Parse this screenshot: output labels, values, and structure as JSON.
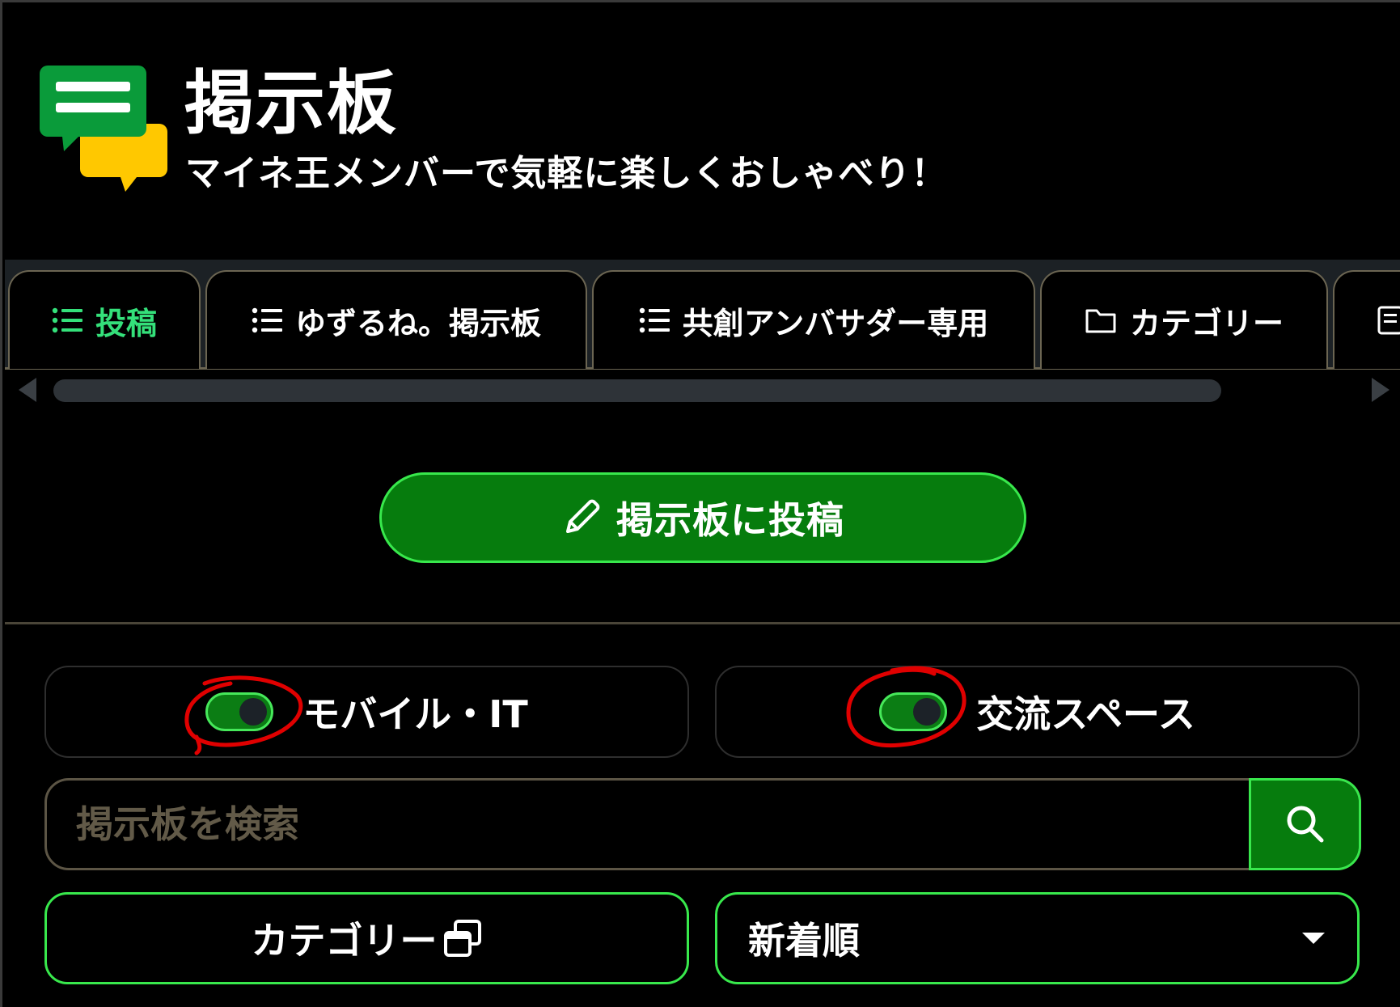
{
  "header": {
    "title": "掲示板",
    "subtitle": "マイネ王メンバーで気軽に楽しくおしゃべり！",
    "logo_icon": "chat-bubbles-icon"
  },
  "tabs": [
    {
      "label": "投稿",
      "icon": "list-icon",
      "active": true
    },
    {
      "label": "ゆずるね。掲示板",
      "icon": "list-icon",
      "active": false
    },
    {
      "label": "共創アンバサダー専用",
      "icon": "list-icon",
      "active": false
    },
    {
      "label": "カテゴリー",
      "icon": "folder-icon",
      "active": false
    },
    {
      "label": "",
      "icon": "book-icon",
      "active": false
    }
  ],
  "post_button": {
    "label": "掲示板に投稿",
    "icon": "pencil-icon"
  },
  "toggles": [
    {
      "label": "モバイル・IT",
      "on": true
    },
    {
      "label": "交流スペース",
      "on": true
    }
  ],
  "search": {
    "placeholder": "掲示板を検索",
    "value": "",
    "icon": "search-icon"
  },
  "category_button": {
    "label": "カテゴリー",
    "icon": "open-modal-icon"
  },
  "sort_select": {
    "selected": "新着順"
  },
  "colors": {
    "background": "#000000",
    "accent_green": "#067c0d",
    "border_green": "#38e84c",
    "active_tab": "#34e07a",
    "annotation_red": "#e00000"
  }
}
